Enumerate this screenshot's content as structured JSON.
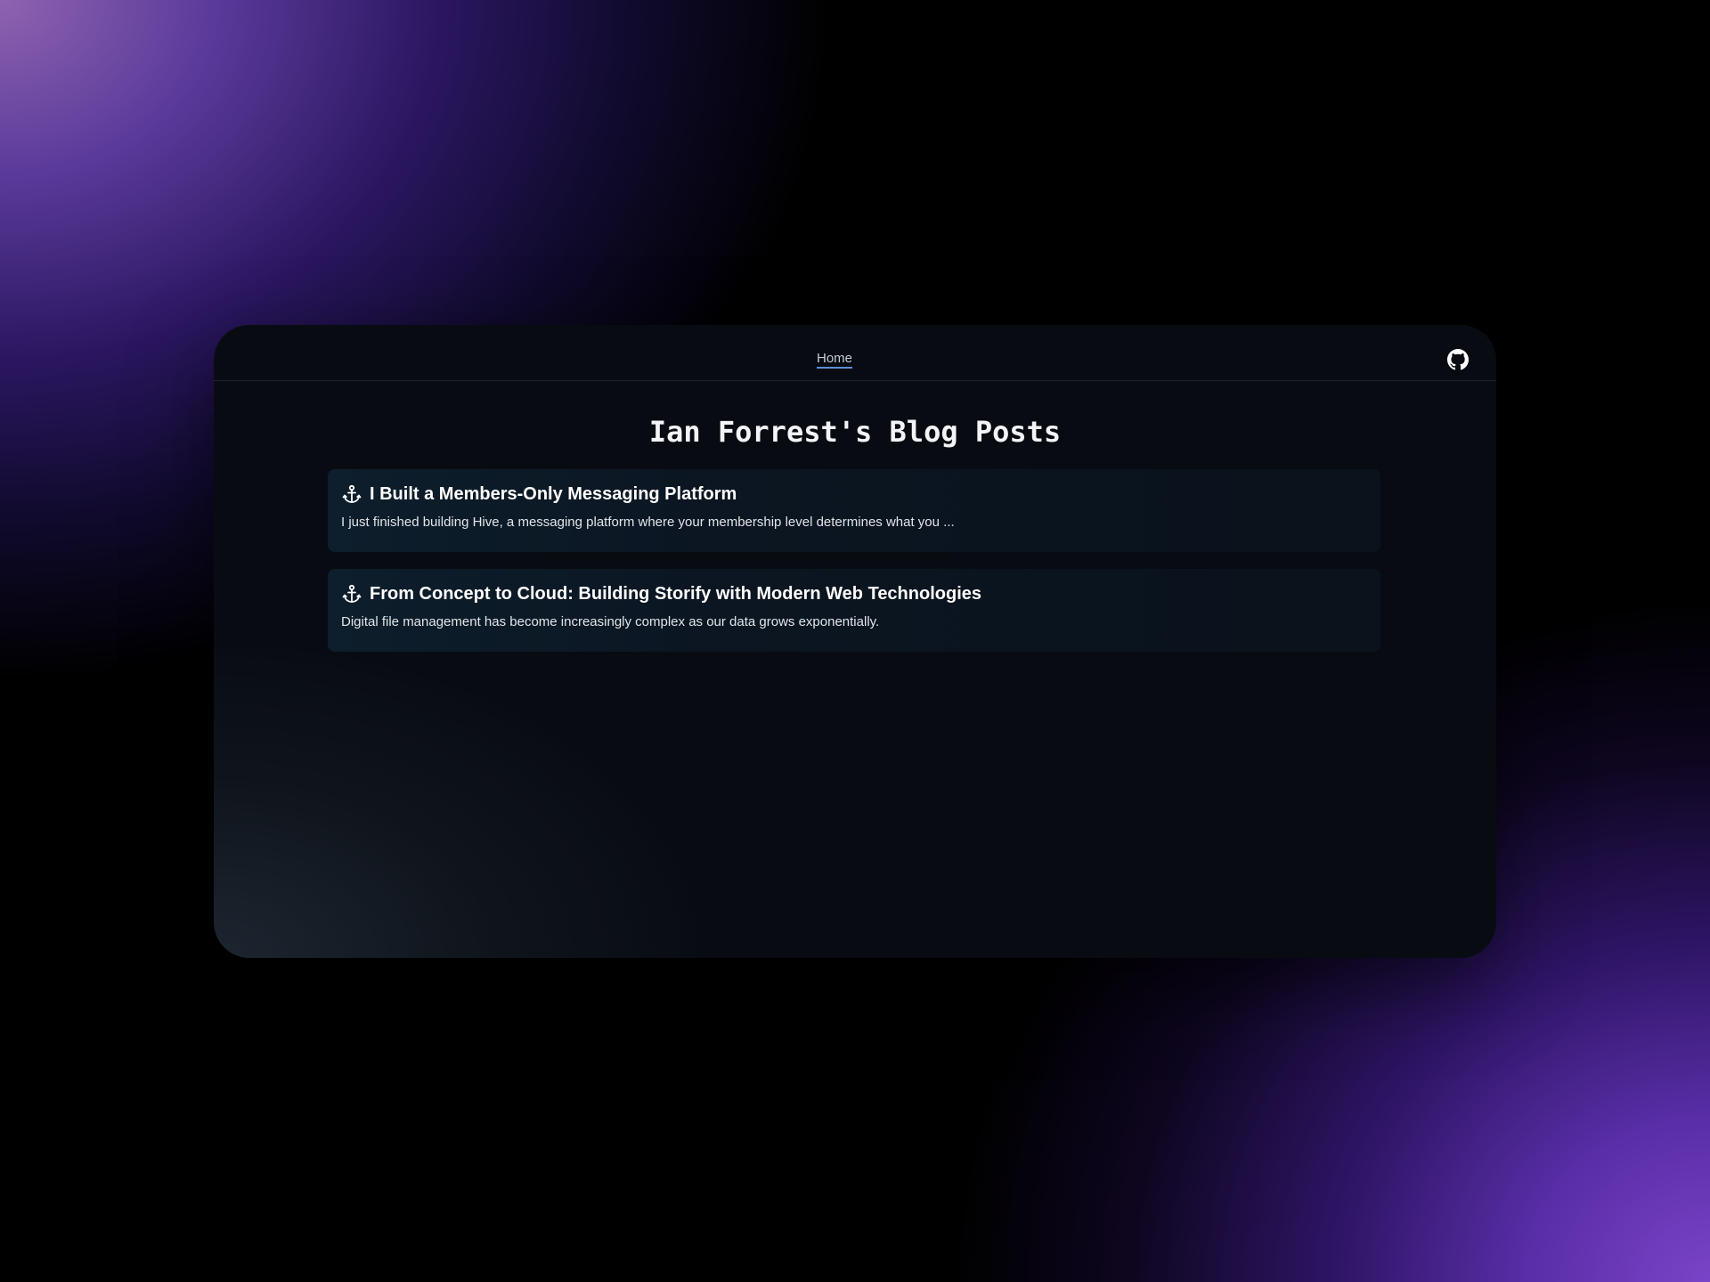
{
  "nav": {
    "home_label": "Home",
    "github_icon": "github-icon"
  },
  "page": {
    "title": "Ian Forrest's Blog Posts"
  },
  "posts": [
    {
      "icon": "anchor-icon",
      "title": "I Built a Members-Only Messaging Platform",
      "excerpt": "I just finished building Hive, a messaging platform where your membership level determines what you ..."
    },
    {
      "icon": "anchor-icon",
      "title": "From Concept to Cloud: Building Storify with Modern Web Technologies",
      "excerpt": "Digital file management has become increasingly complex as our data grows exponentially."
    }
  ],
  "colors": {
    "nav_underline": "#5a8fd6",
    "window_bg": "#080c12",
    "card_bg": "#0b1622"
  }
}
